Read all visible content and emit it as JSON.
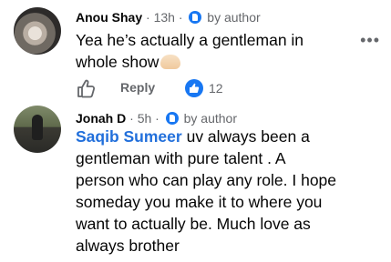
{
  "comments": [
    {
      "author": "Anou Shay",
      "time": "13h",
      "badge_label": "by author",
      "text_line1": "Yea he’s actually a gentleman in",
      "text_line2": "whole show",
      "emoji": "hand-emoji",
      "actions": {
        "reply_label": "Reply",
        "like_count": "12"
      }
    },
    {
      "author": "Jonah D",
      "time": "5h",
      "badge_label": "by author",
      "mention": "Saqib Sumeer",
      "text_line1_rest": " uv always been a",
      "text_lines": [
        "gentleman with pure talent . A",
        "person who can play any role. I hope",
        "someday you make it to where you",
        "want to actually be. Much love as",
        "always brother"
      ]
    }
  ],
  "more_label": "•••",
  "dot": "·"
}
